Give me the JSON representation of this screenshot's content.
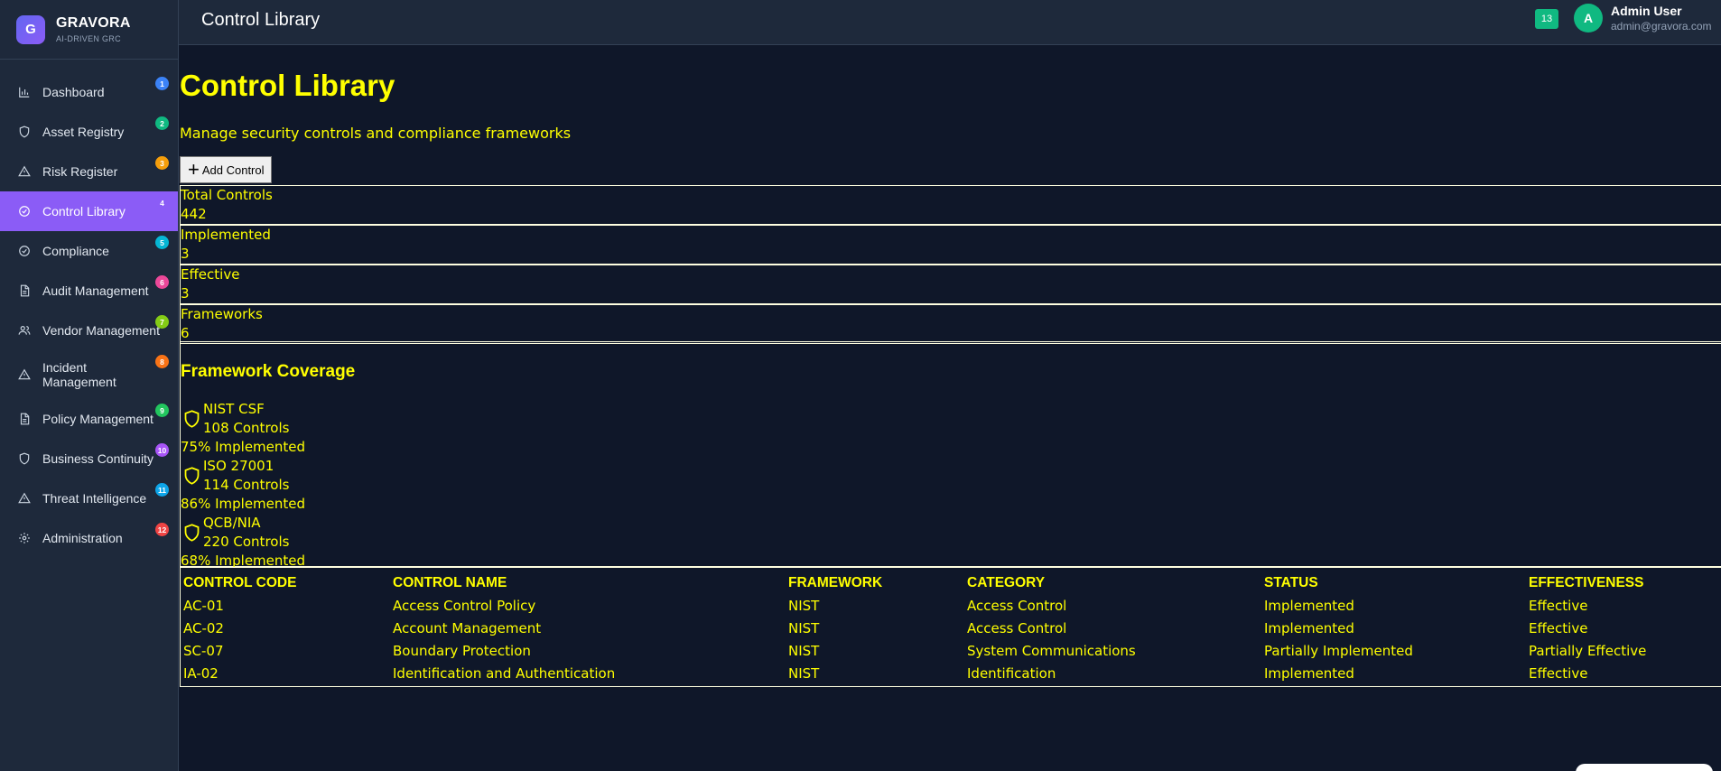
{
  "brand": {
    "logo_letter": "G",
    "name": "GRAVORA",
    "tagline": "AI-DRIVEN GRC"
  },
  "sidebar": {
    "items": [
      {
        "label": "Dashboard",
        "icon": "bar-chart-icon",
        "badge": "1",
        "badge_color": "#3b82f6"
      },
      {
        "label": "Asset Registry",
        "icon": "shield-icon",
        "badge": "2",
        "badge_color": "#10b981"
      },
      {
        "label": "Risk Register",
        "icon": "warning-icon",
        "badge": "3",
        "badge_color": "#f59e0b"
      },
      {
        "label": "Control Library",
        "icon": "check-circle-icon",
        "badge": "4",
        "badge_color": "#8b5cf6"
      },
      {
        "label": "Compliance",
        "icon": "check-circle-icon",
        "badge": "5",
        "badge_color": "#06b6d4"
      },
      {
        "label": "Audit Management",
        "icon": "document-icon",
        "badge": "6",
        "badge_color": "#ec4899"
      },
      {
        "label": "Vendor Management",
        "icon": "users-icon",
        "badge": "7",
        "badge_color": "#84cc16"
      },
      {
        "label": "Incident Management",
        "icon": "warning-icon",
        "badge": "8",
        "badge_color": "#f97316"
      },
      {
        "label": "Policy Management",
        "icon": "document-icon",
        "badge": "9",
        "badge_color": "#22c55e"
      },
      {
        "label": "Business Continuity",
        "icon": "shield-icon",
        "badge": "10",
        "badge_color": "#a855f7"
      },
      {
        "label": "Threat Intelligence",
        "icon": "warning-icon",
        "badge": "11",
        "badge_color": "#0ea5e9"
      },
      {
        "label": "Administration",
        "icon": "gear-icon",
        "badge": "12",
        "badge_color": "#ef4444"
      }
    ],
    "active": "Control Library"
  },
  "header": {
    "title": "Control Library",
    "notification_count": "13",
    "user_initial": "A",
    "user_name": "Admin User",
    "user_email": "admin@gravora.com"
  },
  "main": {
    "title": "Control Library",
    "subtitle": "Manage security controls and compliance frameworks",
    "add_button": "Add Control",
    "stats": [
      {
        "label": "Total Controls",
        "value": "442"
      },
      {
        "label": "Implemented",
        "value": "3"
      },
      {
        "label": "Effective",
        "value": "3"
      },
      {
        "label": "Frameworks",
        "value": "6"
      }
    ],
    "framework_heading": "Framework Coverage",
    "frameworks": [
      {
        "name": "NIST CSF",
        "controls": "108 Controls",
        "implemented": "75% Implemented"
      },
      {
        "name": "ISO 27001",
        "controls": "114 Controls",
        "implemented": "86% Implemented"
      },
      {
        "name": "QCB/NIA",
        "controls": "220 Controls",
        "implemented": "68% Implemented"
      }
    ],
    "table": {
      "headers": [
        "CONTROL CODE",
        "CONTROL NAME",
        "FRAMEWORK",
        "CATEGORY",
        "STATUS",
        "EFFECTIVENESS"
      ],
      "rows": [
        [
          "AC-01",
          "Access Control Policy",
          "NIST",
          "Access Control",
          "Implemented",
          "Effective"
        ],
        [
          "AC-02",
          "Account Management",
          "NIST",
          "Access Control",
          "Implemented",
          "Effective"
        ],
        [
          "SC-07",
          "Boundary Protection",
          "NIST",
          "System Communications",
          "Partially Implemented",
          "Partially Effective"
        ],
        [
          "IA-02",
          "Identification and Authentication",
          "NIST",
          "Identification",
          "Implemented",
          "Effective"
        ]
      ]
    }
  },
  "colors": {
    "accent": "#8b5cf6",
    "text_highlight": "#ffff00",
    "background": "#0f1729",
    "panel": "#1e293b"
  }
}
